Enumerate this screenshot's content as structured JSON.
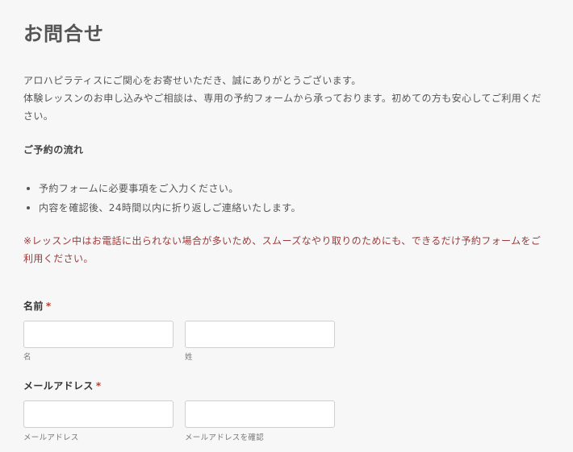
{
  "page": {
    "title": "お問合せ",
    "intro_line1": "アロハピラティスにご関心をお寄せいただき、誠にありがとうございます。",
    "intro_line2": "体験レッスンのお申し込みやご相談は、専用の予約フォームから承っております。初めての方も安心してご利用ください。",
    "flow_heading": "ご予約の流れ",
    "steps": [
      {
        "text": "予約フォームに必要事項をご入力ください。"
      },
      {
        "text": "内容を確認後、24時間以内に折り返しご連絡いたします。"
      }
    ],
    "notice": "※レッスン中はお電話に出られない場合が多いため、スムーズなやり取りのためにも、できるだけ予約フォームをご利用ください。"
  },
  "form": {
    "required_mark": "*",
    "name": {
      "label": "名前",
      "first_value": "",
      "last_value": "",
      "first_sublabel": "名",
      "last_sublabel": "姓"
    },
    "email": {
      "label": "メールアドレス",
      "value": "",
      "confirm_value": "",
      "sublabel": "メールアドレス",
      "confirm_sublabel": "メールアドレスを確認"
    }
  },
  "colors": {
    "background": "#f7f7f7",
    "text": "#555555",
    "notice": "#9a3b3b",
    "required": "#c0392b"
  }
}
